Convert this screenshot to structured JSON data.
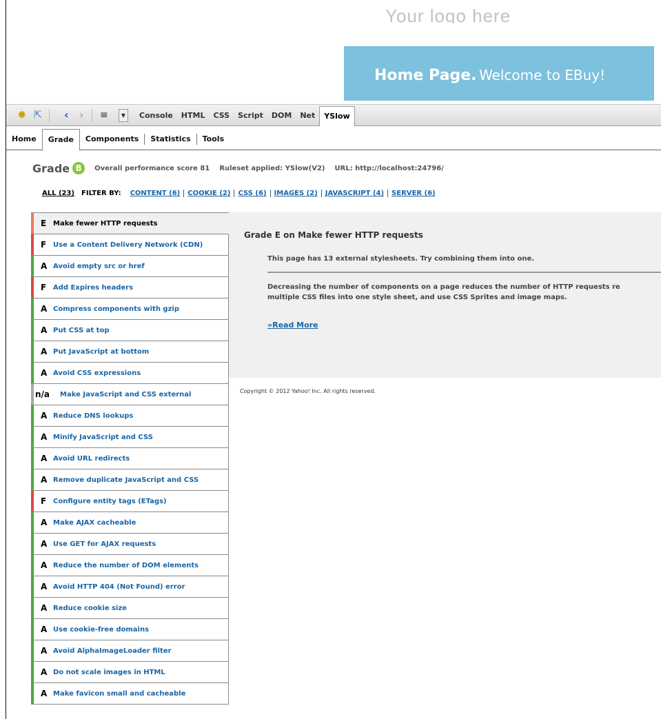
{
  "site": {
    "logo_text": "Your logo here",
    "banner_strong": "Home Page.",
    "banner_light": "Welcome to EBuy!"
  },
  "toolbar": {
    "tabs": [
      "Console",
      "HTML",
      "CSS",
      "Script",
      "DOM",
      "Net",
      "YSlow"
    ],
    "active_tab": "YSlow"
  },
  "yslow_nav": [
    "Home",
    "Grade",
    "Components",
    "Statistics",
    "Tools"
  ],
  "grade": {
    "label": "Grade",
    "letter": "B",
    "score_text": "Overall performance score 81",
    "ruleset_text": "Ruleset applied: YSlow(V2)",
    "url_text": "URL: http://localhost:24796/"
  },
  "filter": {
    "all": "ALL (23)",
    "by": "FILTER BY:",
    "links": [
      "CONTENT (6)",
      "COOKIE (2)",
      "CSS (6)",
      "IMAGES (2)",
      "JAVASCRIPT (4)",
      "SERVER (6)"
    ]
  },
  "rules": [
    {
      "grade": "E",
      "name": "Make fewer HTTP requests"
    },
    {
      "grade": "F",
      "name": "Use a Content Delivery Network (CDN)"
    },
    {
      "grade": "A",
      "name": "Avoid empty src or href"
    },
    {
      "grade": "F",
      "name": "Add Expires headers"
    },
    {
      "grade": "A",
      "name": "Compress components with gzip"
    },
    {
      "grade": "A",
      "name": "Put CSS at top"
    },
    {
      "grade": "A",
      "name": "Put JavaScript at bottom"
    },
    {
      "grade": "A",
      "name": "Avoid CSS expressions"
    },
    {
      "grade": "n/a",
      "name": "Make JavaScript and CSS external"
    },
    {
      "grade": "A",
      "name": "Reduce DNS lookups"
    },
    {
      "grade": "A",
      "name": "Minify JavaScript and CSS"
    },
    {
      "grade": "A",
      "name": "Avoid URL redirects"
    },
    {
      "grade": "A",
      "name": "Remove duplicate JavaScript and CSS"
    },
    {
      "grade": "F",
      "name": "Configure entity tags (ETags)"
    },
    {
      "grade": "A",
      "name": "Make AJAX cacheable"
    },
    {
      "grade": "A",
      "name": "Use GET for AJAX requests"
    },
    {
      "grade": "A",
      "name": "Reduce the number of DOM elements"
    },
    {
      "grade": "A",
      "name": "Avoid HTTP 404 (Not Found) error"
    },
    {
      "grade": "A",
      "name": "Reduce cookie size"
    },
    {
      "grade": "A",
      "name": "Use cookie-free domains"
    },
    {
      "grade": "A",
      "name": "Avoid AlphaImageLoader filter"
    },
    {
      "grade": "A",
      "name": "Do not scale images in HTML"
    },
    {
      "grade": "A",
      "name": "Make favicon small and cacheable"
    }
  ],
  "detail": {
    "title": "Grade E on Make fewer HTTP requests",
    "text": "This page has 13 external stylesheets. Try combining them into one.",
    "desc_line1": "Decreasing the number of components on a page reduces the number of HTTP requests re",
    "desc_line2": "multiple CSS files into one style sheet, and use CSS Sprites and image maps.",
    "read_more": "»Read More"
  },
  "copyright": "Copyright © 2012 Yahoo! Inc. All rights reserved.",
  "colors": {
    "banner": "#7cc1dd",
    "grade_badge": "#8ac43f",
    "grade_A": "#4aa83b",
    "grade_F": "#e0434b",
    "grade_E": "#ed7b5f",
    "grade_na": "#a8a8a8",
    "link": "#1a65a6"
  }
}
